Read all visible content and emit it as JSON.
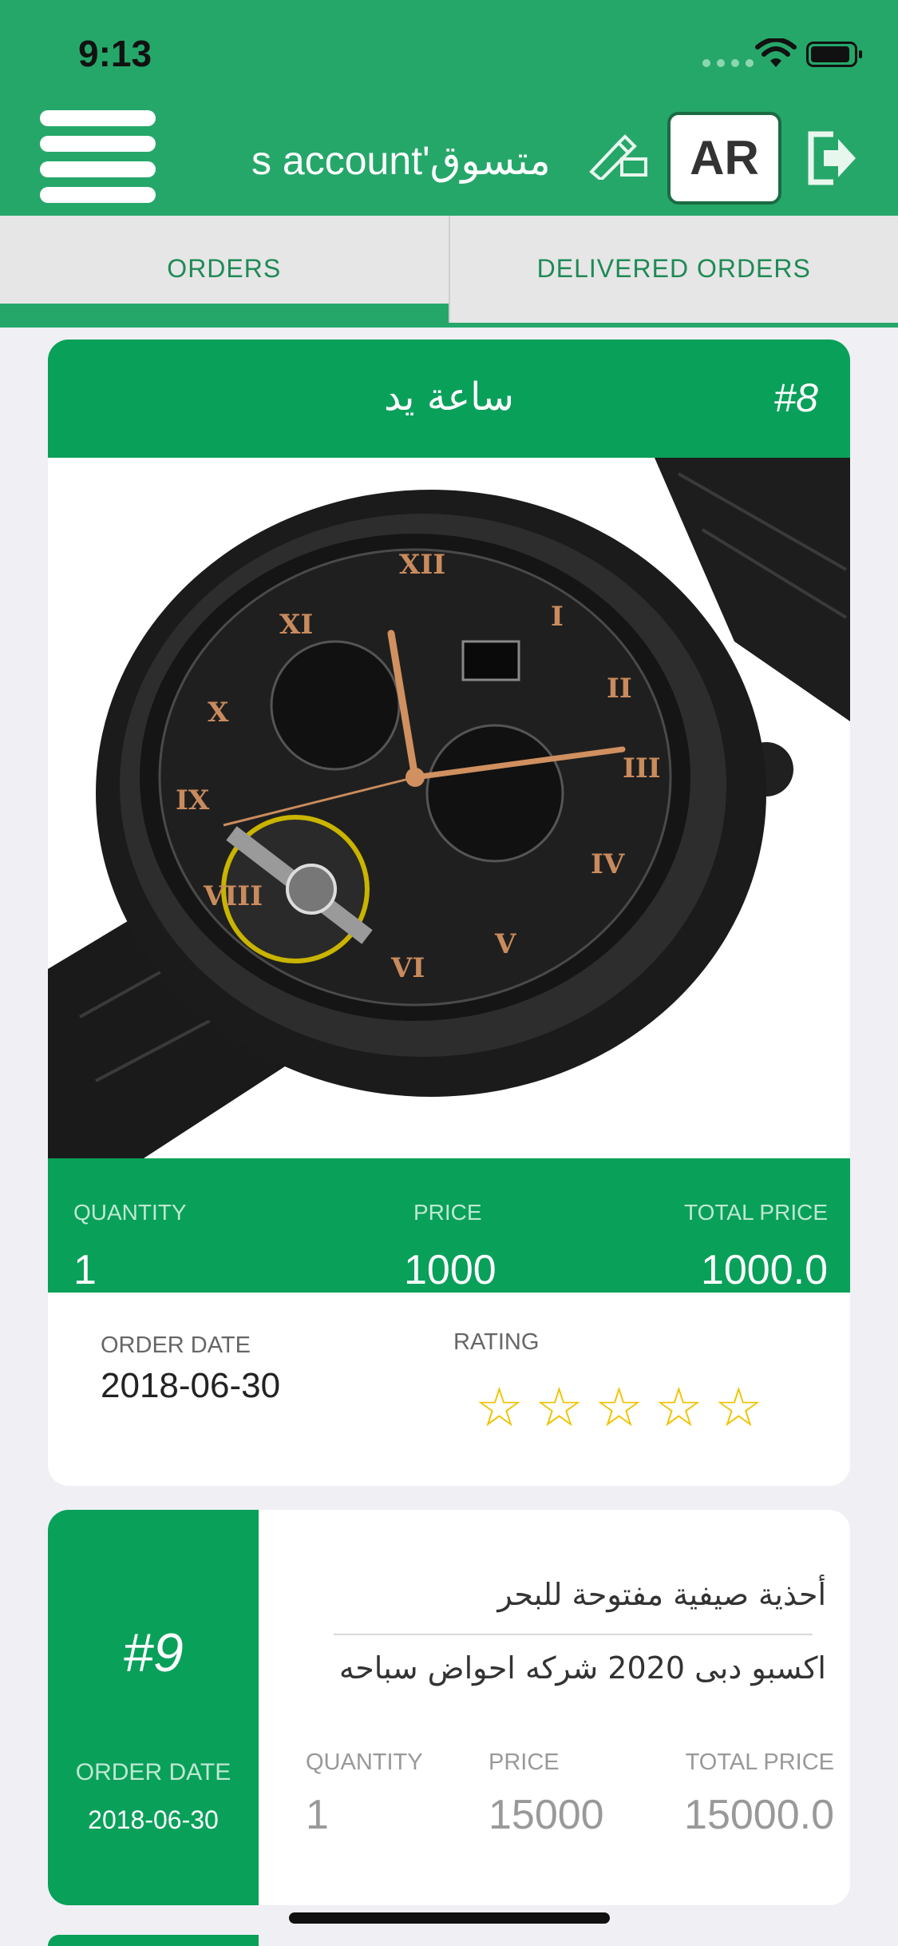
{
  "status_bar": {
    "time": "9:13"
  },
  "header": {
    "account_title": "s account'متسوق",
    "language_button": "AR",
    "icons": [
      "menu-icon",
      "edit-icon",
      "logout-icon"
    ]
  },
  "tabs": [
    {
      "label": "ORDERS",
      "active": true
    },
    {
      "label": "DELIVERED ORDERS",
      "active": false
    }
  ],
  "orders": [
    {
      "number": "#8",
      "title": "ساعة يد",
      "quantity_label": "QUANTITY",
      "quantity": "1",
      "price_label": "PRICE",
      "price": "1000",
      "total_label": "TOTAL PRICE",
      "total": "1000.0",
      "order_date_label": "ORDER DATE",
      "order_date": "2018-06-30",
      "rating_label": "RATING",
      "rating_stars": 5,
      "rating_value": 0
    },
    {
      "number": "#9",
      "title": "أحذية صيفية مفتوحة للبحر",
      "subtitle": "اكسبو دبى 2020 شركه احواض سباحه",
      "quantity_label": "QUANTITY",
      "quantity": "1",
      "price_label": "PRICE",
      "price": "15000",
      "total_label": "TOTAL PRICE",
      "total": "15000.0",
      "order_date_label": "ORDER DATE",
      "order_date": "2018-06-30"
    }
  ],
  "colors": {
    "primary": "#26a76a",
    "card_green": "#09a05a",
    "star": "#f0c300"
  }
}
